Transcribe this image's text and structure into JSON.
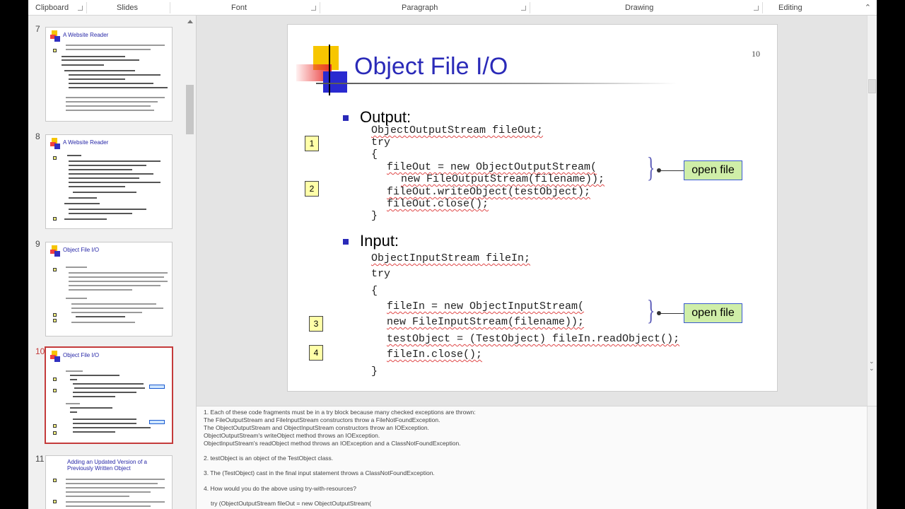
{
  "ribbon": {
    "groups": [
      "Clipboard",
      "Slides",
      "Font",
      "Paragraph",
      "Drawing",
      "Editing"
    ]
  },
  "thumbnails": [
    {
      "num": "7",
      "title": "A Website Reader",
      "selected": false
    },
    {
      "num": "8",
      "title": "A Website Reader",
      "selected": false
    },
    {
      "num": "9",
      "title": "Object File I/O",
      "selected": false
    },
    {
      "num": "10",
      "title": "Object File I/O",
      "selected": true
    },
    {
      "num": "11",
      "title": "Adding an Updated Version of a Previously Written Object",
      "selected": false
    }
  ],
  "slide": {
    "title": "Object File I/O",
    "number": "10",
    "output_heading": "Output:",
    "input_heading": "Input:",
    "output_code": [
      "ObjectOutputStream fileOut;",
      "try",
      "{",
      "fileOut = new ObjectOutputStream(",
      "new FileOutputStream(filename));",
      "fileOut.writeObject(testObject);",
      "fileOut.close();",
      "}"
    ],
    "input_code": [
      "ObjectInputStream fileIn;",
      "try",
      "{",
      "fileIn = new ObjectInputStream(",
      "new FileInputStream(filename));",
      "testObject = (TestObject) fileIn.readObject();",
      "fileIn.close();",
      "}"
    ],
    "markers": [
      "1",
      "2",
      "3",
      "4"
    ],
    "callout_label": "open file"
  },
  "notes": [
    "1.  Each of these code fragments must be in a try block because many checked exceptions are thrown:",
    "The FileOutputStream and FileInputStream constructors throw a FileNotFoundException.",
    "The ObjectOutputStream and ObjectInputStream constructors throw an IOException.",
    "ObjectOutputStream's writeObject method throws an IOException.",
    "ObjectInputStream's readObject method throws an IOException and a ClassNotFoundException.",
    "2.  testObject is an object of the TestObject class.",
    "3.  The (TestObject) cast in the final input statement throws a ClassNotFoundException.",
    "4.  How would you do the above using try-with-resources?",
    "try (ObjectOutputStream fileOut = new ObjectOutputStream("
  ]
}
